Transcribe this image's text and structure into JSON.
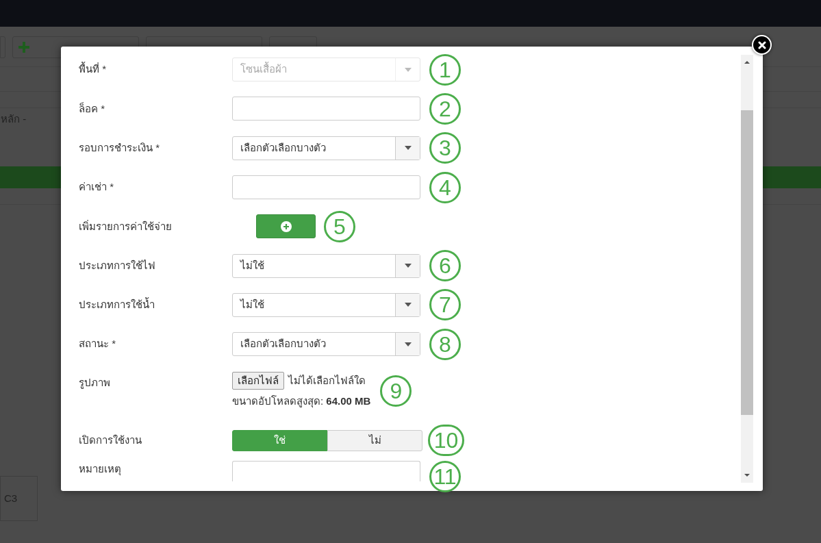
{
  "background": {
    "label_fragment": "หลัก -",
    "card": "C3"
  },
  "modal": {
    "rows": [
      {
        "kind": "select",
        "label": "พื้นที่ *",
        "value": "โซนเสื้อผ้า",
        "disabled": true,
        "marker": "1"
      },
      {
        "kind": "text",
        "label": "ล็อค *",
        "marker": "2"
      },
      {
        "kind": "select",
        "label": "รอบการชำระเงิน *",
        "value": "เลือกตัวเลือกบางตัว",
        "disabled": false,
        "marker": "3"
      },
      {
        "kind": "text",
        "label": "ค่าเช่า *",
        "marker": "4"
      },
      {
        "kind": "add",
        "label": "เพิ่มรายการค่าใช้จ่าย",
        "marker": "5"
      },
      {
        "kind": "select",
        "label": "ประเภทการใช้ไฟ",
        "value": "ไม่ใช้",
        "disabled": false,
        "marker": "6"
      },
      {
        "kind": "select",
        "label": "ประเภทการใช้น้ำ",
        "value": "ไม่ใช้",
        "disabled": false,
        "marker": "7"
      },
      {
        "kind": "select",
        "label": "สถานะ *",
        "value": "เลือกตัวเลือกบางตัว",
        "disabled": false,
        "marker": "8"
      },
      {
        "kind": "file",
        "label": "รูปภาพ",
        "button": "เลือกไฟล์",
        "status": "ไม่ได้เลือกไฟล์ใด",
        "hint": "ขนาดอัปโหลดสูงสุด: **64.00 MB**",
        "marker": "9"
      },
      {
        "kind": "toggle",
        "label": "เปิดการใช้งาน",
        "options": [
          {
            "label": "ใช่",
            "selected": true
          },
          {
            "label": "ไม่",
            "selected": false
          }
        ],
        "marker": "10"
      },
      {
        "kind": "textarea",
        "label": "หมายเหตุ",
        "marker": "11"
      }
    ]
  }
}
